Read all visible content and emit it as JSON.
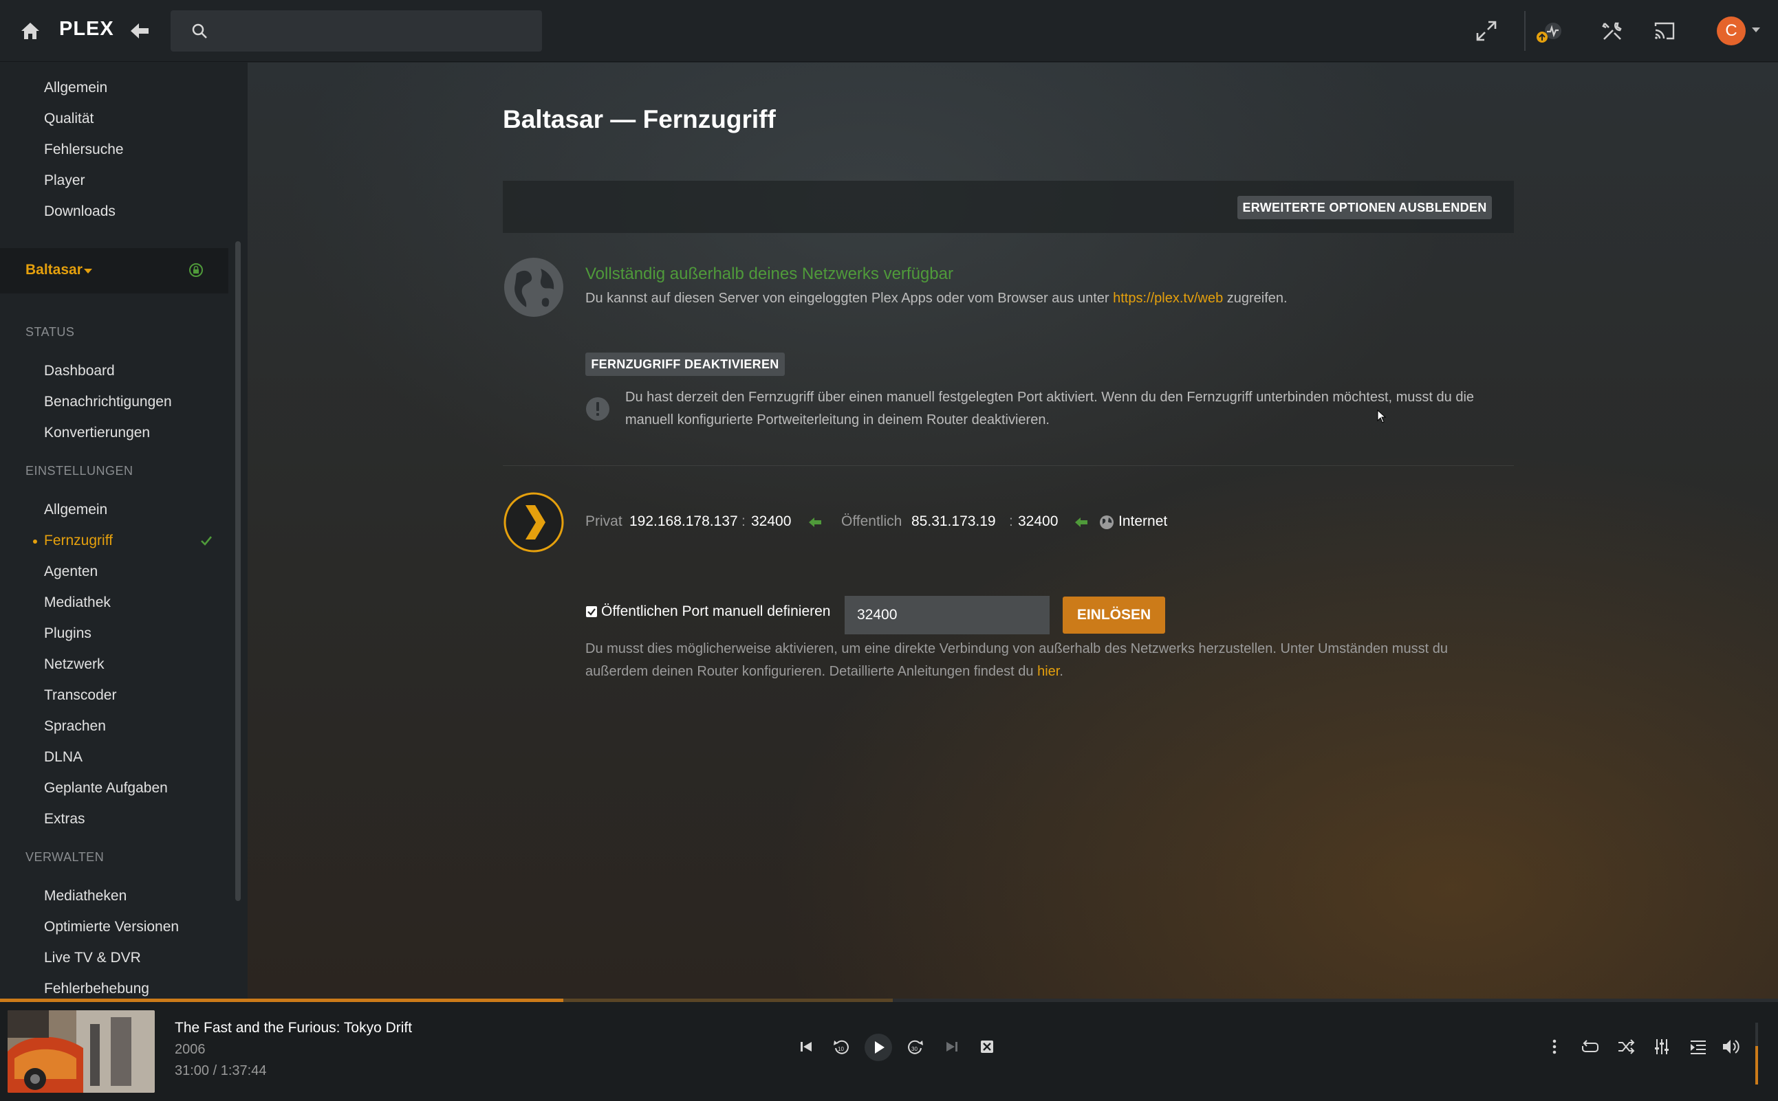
{
  "topbar": {
    "logo_text": "PLEX",
    "search_placeholder": "",
    "avatar_letter": "C"
  },
  "sidebar": {
    "top_items": [
      "Allgemein",
      "Qualität",
      "Fehlersuche",
      "Player",
      "Downloads"
    ],
    "server_name": "Baltasar",
    "sections": {
      "status": {
        "heading": "STATUS",
        "items": [
          "Dashboard",
          "Benachrichtigungen",
          "Konvertierungen"
        ]
      },
      "settings": {
        "heading": "EINSTELLUNGEN",
        "items": [
          "Allgemein",
          "Fernzugriff",
          "Agenten",
          "Mediathek",
          "Plugins",
          "Netzwerk",
          "Transcoder",
          "Sprachen",
          "DLNA",
          "Geplante Aufgaben",
          "Extras"
        ],
        "active": "Fernzugriff"
      },
      "manage": {
        "heading": "VERWALTEN",
        "items": [
          "Mediatheken",
          "Optimierte Versionen",
          "Live TV & DVR",
          "Fehlerbehebung"
        ]
      }
    }
  },
  "main": {
    "title": "Baltasar — Fernzugriff",
    "advanced_button": "ERWEITERTE OPTIONEN AUSBLENDEN",
    "status_title": "Vollständig außerhalb deines Netzwerks verfügbar",
    "status_text_pre": "Du kannst auf diesen Server von eingeloggten Plex Apps oder vom Browser aus unter ",
    "status_link": "https://plex.tv/web",
    "status_text_post": " zugreifen.",
    "deactivate_button": "FERNZUGRIFF DEAKTIVIEREN",
    "warning_text": "Du hast derzeit den Fernzugriff über einen manuell festgelegten Port aktiviert. Wenn du den Fernzugriff unterbinden möchtest, musst du die manuell konfigurierte Portweiterleitung in deinem Router deaktivieren.",
    "connection": {
      "private_label": "Privat",
      "private_ip": "192.168.178.137",
      "private_port": "32400",
      "public_label": "Öffentlich",
      "public_ip": "85.31.173.19",
      "public_port": "32400",
      "internet_label": "Internet",
      "separator": ":"
    },
    "manual_port_label": "Öffentlichen Port manuell definieren",
    "manual_port_checked": true,
    "port_value": "32400",
    "redeem_button": "EINLÖSEN",
    "hint_text_pre": "Du musst dies möglicherweise aktivieren, um eine direkte Verbindung von außerhalb des Netzwerks herzustellen. Unter Umständen musst du außerdem deinen Router konfigurieren. Detaillierte Anleitungen findest du ",
    "hint_link": "hier",
    "hint_text_post": "."
  },
  "player": {
    "title": "The Fast and the Furious: Tokyo Drift",
    "year": "2006",
    "time": "31:00 / 1:37:44",
    "progress_fraction": 0.317,
    "buffer_fraction": 0.502,
    "volume_fraction": 0.62
  },
  "colors": {
    "accent": "#e5a00d",
    "button_orange": "#cc7b19",
    "status_green": "#4f9a3a",
    "background": "#1f2326"
  }
}
